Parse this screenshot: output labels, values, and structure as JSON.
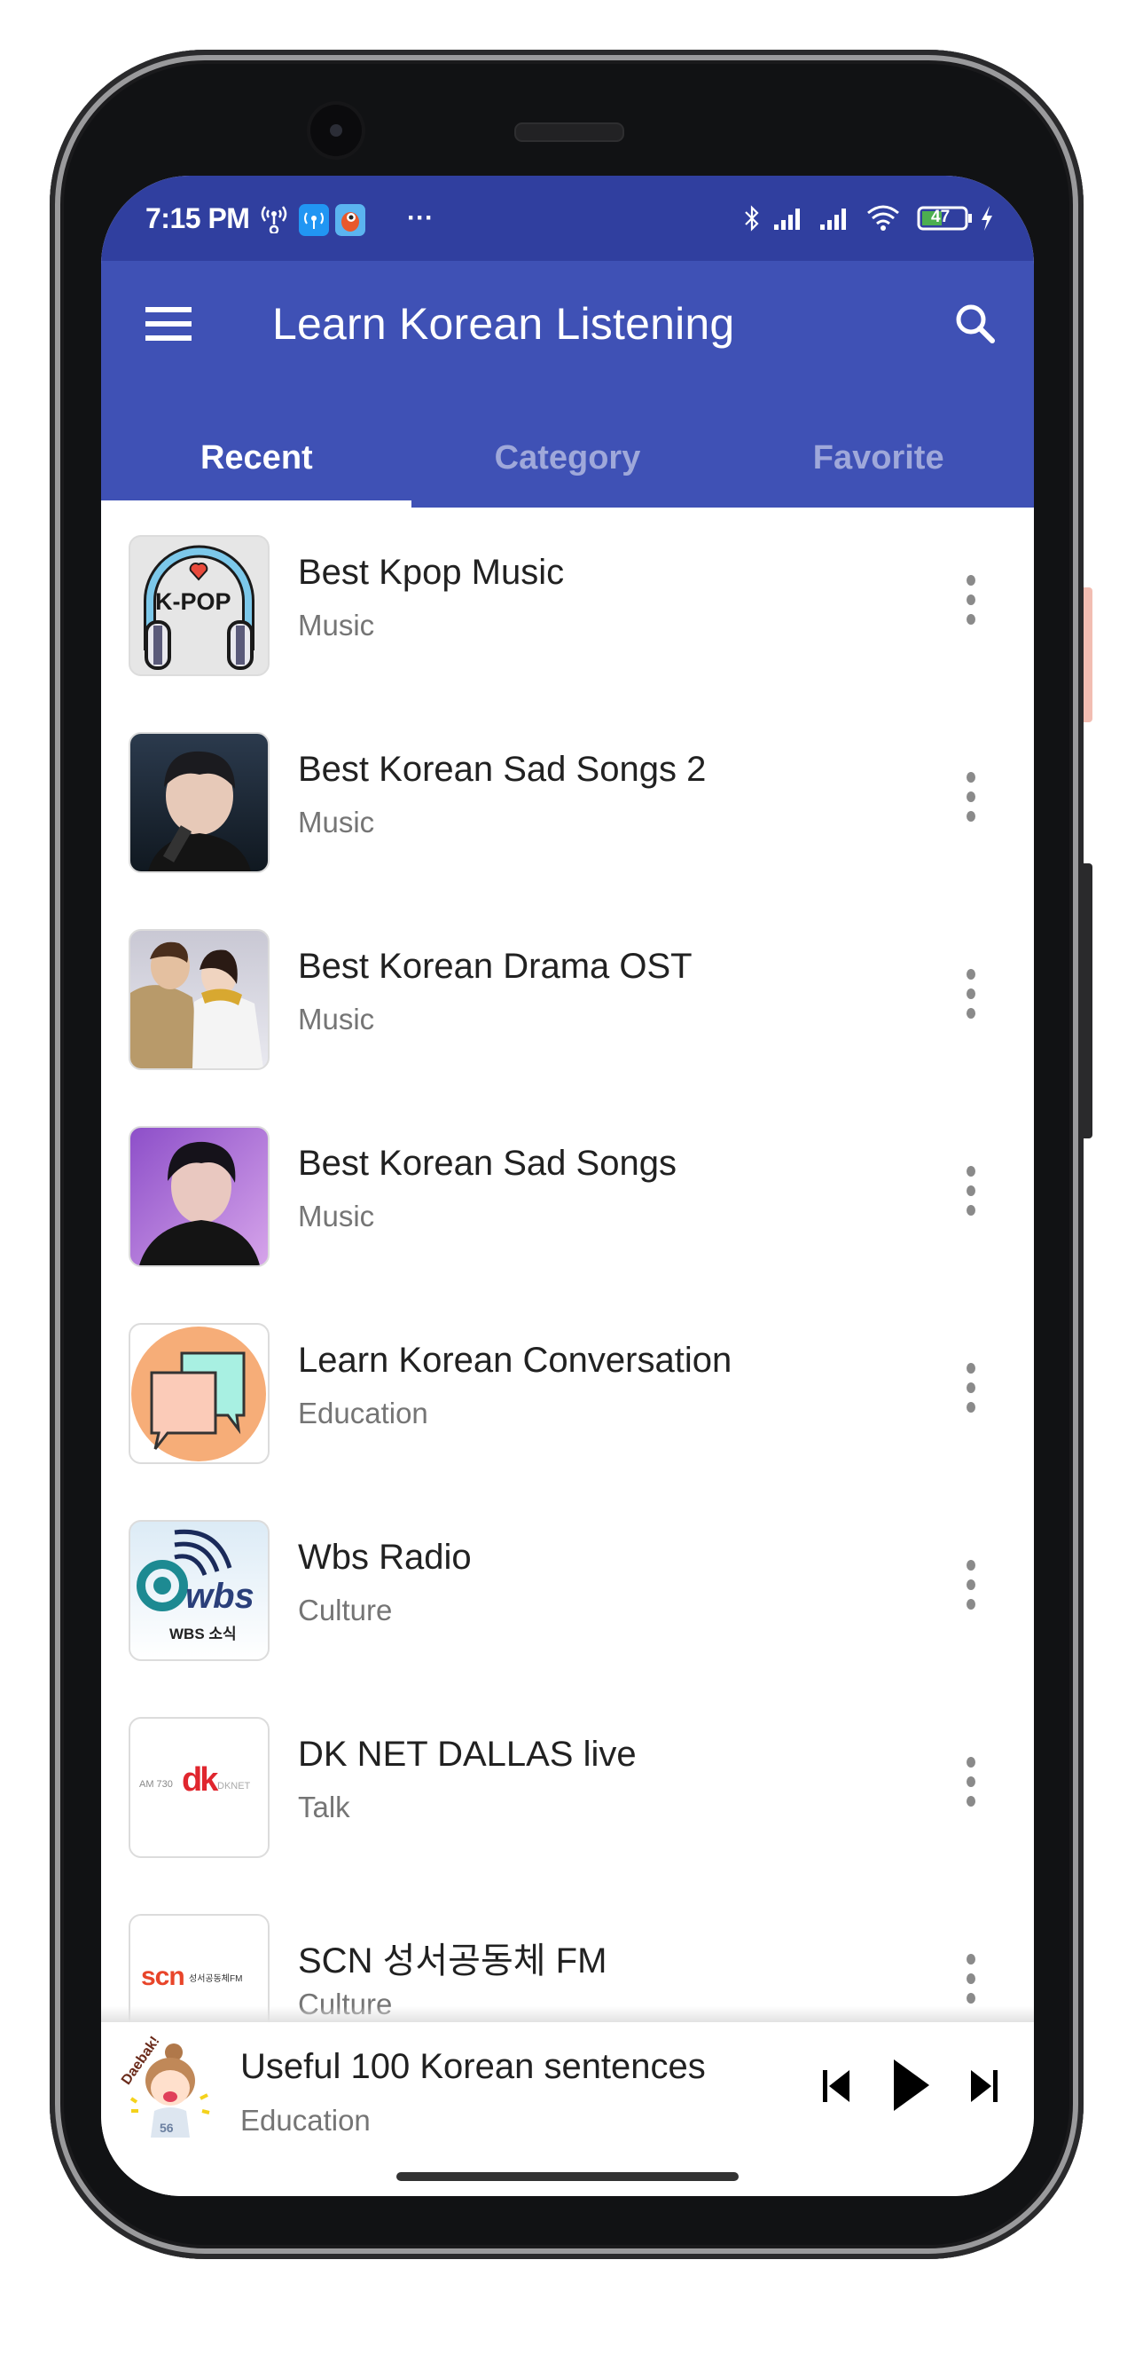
{
  "status_bar": {
    "time": "7:15 PM",
    "left_icons": [
      "hotspot-icon",
      "wifi-app-icon",
      "fish-app-icon",
      "more-notifications-icon"
    ],
    "more_label": "···",
    "right_icons": [
      "bluetooth-icon",
      "signal-icon",
      "signal-icon",
      "wifi-icon",
      "battery-icon",
      "charging-icon"
    ],
    "battery_level": "47",
    "colors": {
      "background": "#303F9F"
    }
  },
  "toolbar": {
    "title": "Learn Korean Listening",
    "menu_icon": "hamburger-icon",
    "search_icon": "search-icon",
    "colors": {
      "background": "#3F51B5"
    }
  },
  "tabs": [
    {
      "label": "Recent",
      "active": true
    },
    {
      "label": "Category",
      "active": false
    },
    {
      "label": "Favorite",
      "active": false
    }
  ],
  "list": {
    "items": [
      {
        "title": "Best Kpop Music",
        "subtitle": "Music",
        "thumb": "kpop-headphones-art",
        "thumb_text": "K-POP"
      },
      {
        "title": "Best Korean Sad Songs 2",
        "subtitle": "Music",
        "thumb": "singer-photo"
      },
      {
        "title": "Best Korean Drama OST",
        "subtitle": "Music",
        "thumb": "drama-couple-photo"
      },
      {
        "title": "Best Korean Sad Songs",
        "subtitle": "Music",
        "thumb": "singer-purple-photo"
      },
      {
        "title": "Learn Korean Conversation",
        "subtitle": "Education",
        "thumb": "chat-bubbles-art"
      },
      {
        "title": "Wbs Radio",
        "subtitle": "Culture",
        "thumb": "wbs-logo",
        "thumb_text": "wbs",
        "thumb_caption": "WBS 소식"
      },
      {
        "title": "DK NET DALLAS live",
        "subtitle": "Talk",
        "thumb": "dknet-logo",
        "thumb_text": "dk",
        "thumb_prefix": "AM 730",
        "thumb_suffix": "DKNET"
      },
      {
        "title": "SCN 성서공동체 FM",
        "subtitle": "Culture",
        "thumb": "scn-logo",
        "thumb_text": "scn",
        "thumb_caption": "성서공동체FM"
      }
    ]
  },
  "player": {
    "title": "Useful 100 Korean sentences",
    "subtitle": "Education",
    "art": "daebak-sticker",
    "art_text": "Daebak!",
    "controls": [
      "skip-previous-icon",
      "play-icon",
      "skip-next-icon"
    ]
  }
}
